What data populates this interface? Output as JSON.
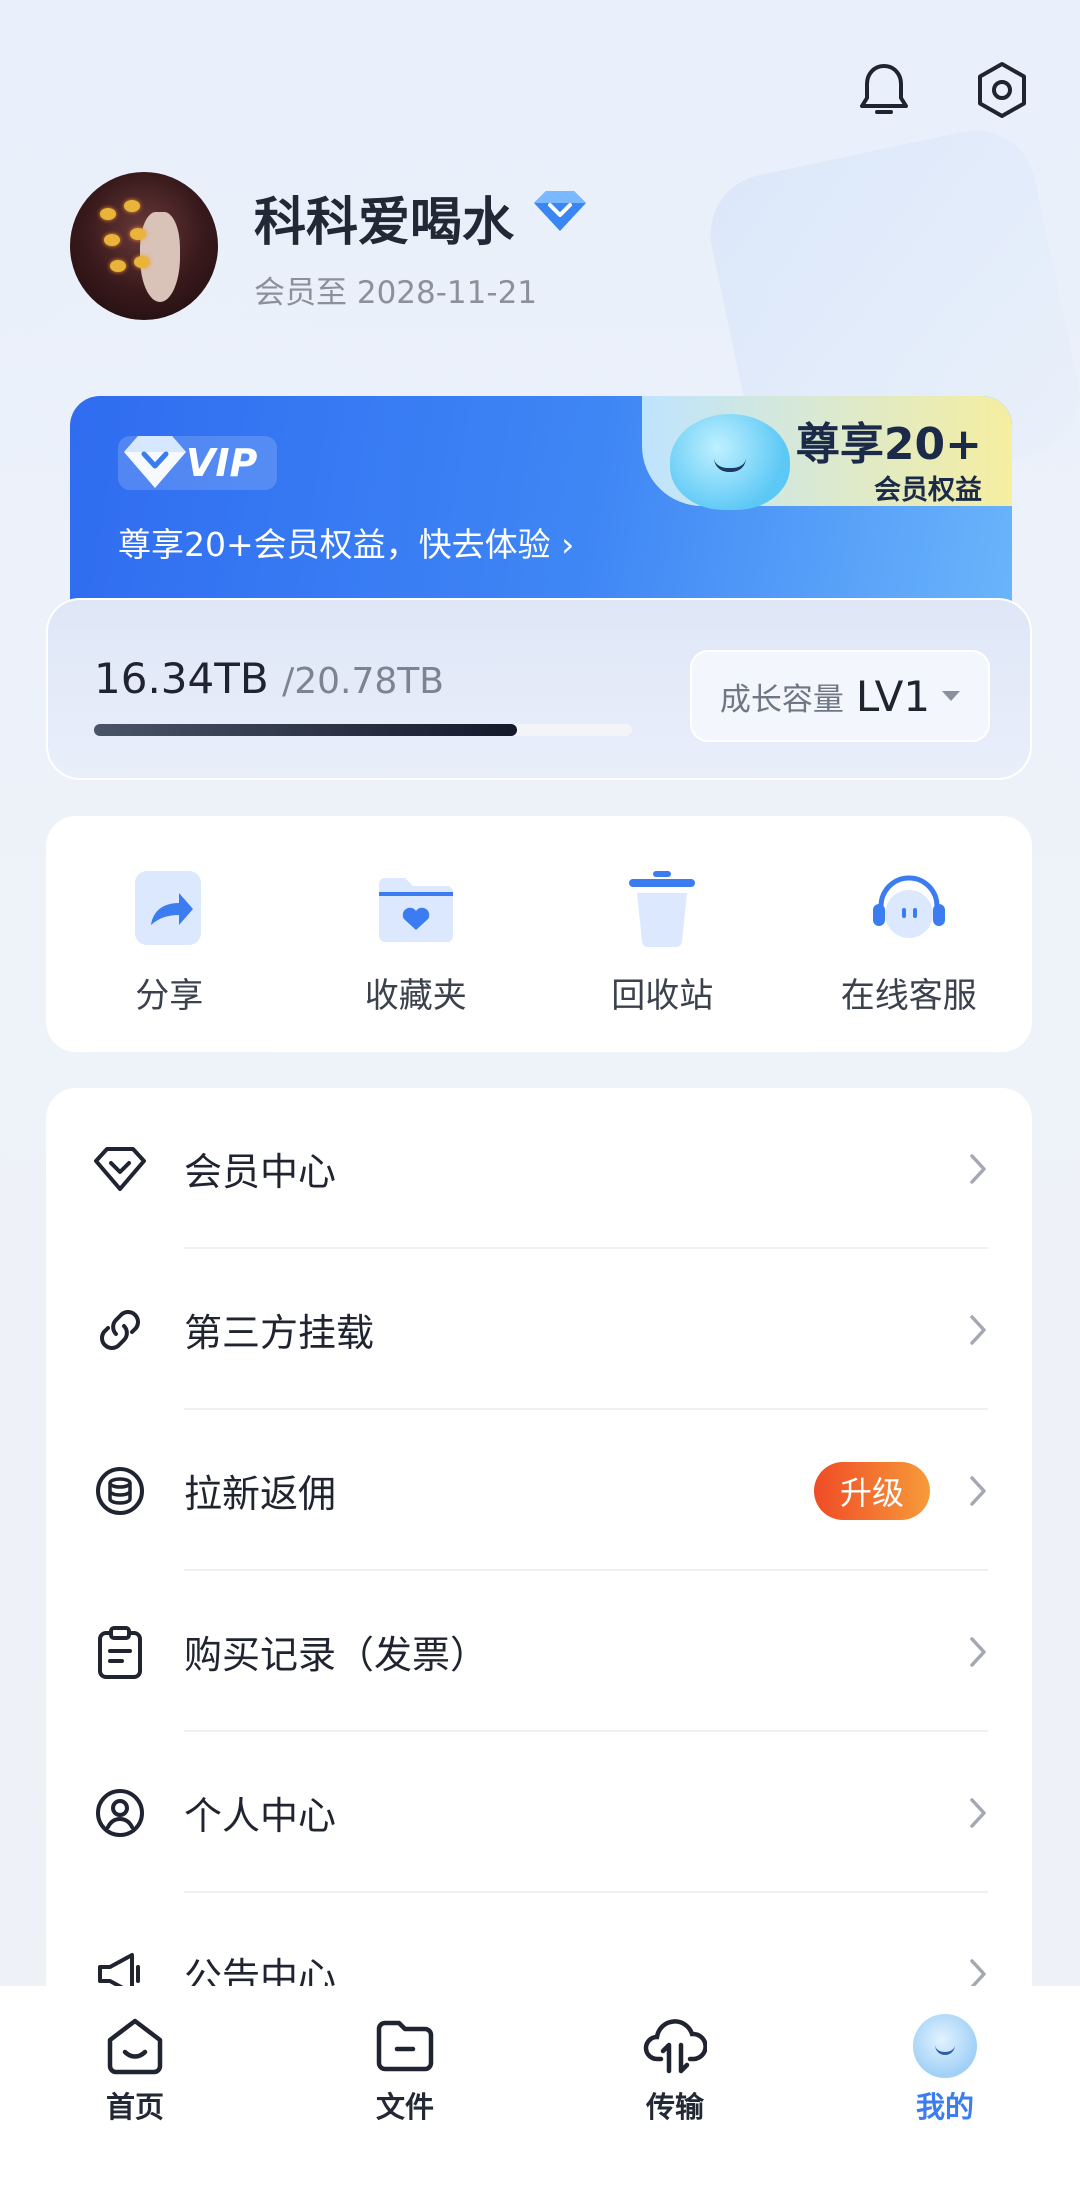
{
  "header": {
    "bell_icon": "bell-icon",
    "settings_icon": "settings-hexagon-icon"
  },
  "profile": {
    "username": "科科爱喝水",
    "member_until": "会员至 2028-11-21",
    "badge_icon": "diamond-icon"
  },
  "vip_banner": {
    "badge_label": "VIP",
    "subtitle": "尊享20+会员权益，快去体验 ›",
    "promo_big": "尊享20+",
    "promo_small": "会员权益"
  },
  "storage": {
    "used": "16.34TB",
    "total": "/20.78TB",
    "used_fraction": 0.786,
    "growth_label": "成长容量",
    "growth_level": "LV1"
  },
  "quick_actions": [
    {
      "label": "分享",
      "icon": "share-icon"
    },
    {
      "label": "收藏夹",
      "icon": "favorites-folder-icon"
    },
    {
      "label": "回收站",
      "icon": "trash-icon"
    },
    {
      "label": "在线客服",
      "icon": "customer-service-icon"
    }
  ],
  "menu": [
    {
      "label": "会员中心",
      "icon": "diamond-outline-icon"
    },
    {
      "label": "第三方挂载",
      "icon": "link-icon"
    },
    {
      "label": "拉新返佣",
      "icon": "coins-icon",
      "badge": "升级"
    },
    {
      "label": "购买记录（发票）",
      "icon": "clipboard-icon"
    },
    {
      "label": "个人中心",
      "icon": "user-circle-icon"
    },
    {
      "label": "公告中心",
      "icon": "megaphone-icon"
    }
  ],
  "tabs": [
    {
      "label": "首页",
      "icon": "home-icon"
    },
    {
      "label": "文件",
      "icon": "folder-icon"
    },
    {
      "label": "传输",
      "icon": "cloud-transfer-icon"
    },
    {
      "label": "我的",
      "icon": "mascot-icon",
      "active": true
    }
  ],
  "colors": {
    "accent": "#3b7cf0",
    "vip_blue": "#2f6cf0",
    "upgrade_badge": "#ef4b26"
  }
}
